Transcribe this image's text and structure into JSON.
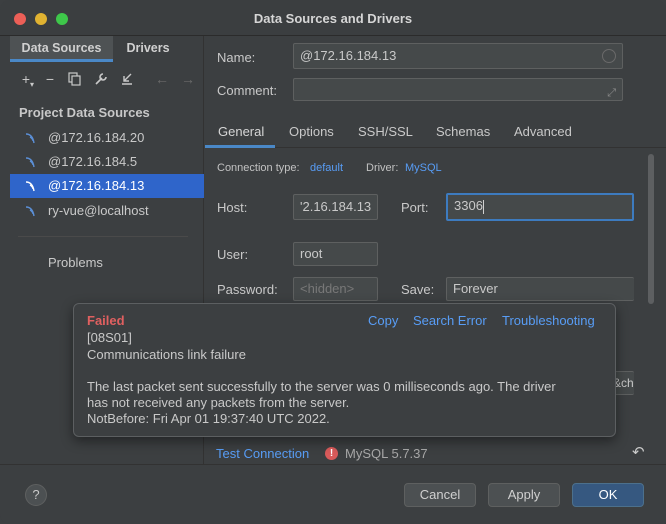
{
  "window": {
    "title": "Data Sources and Drivers"
  },
  "left_tabs": [
    "Data Sources",
    "Drivers"
  ],
  "toolbar_icons": [
    "add-icon",
    "remove-icon",
    "duplicate-icon",
    "wrench-icon",
    "import-icon",
    "back-icon",
    "forward-icon"
  ],
  "section_title": "Project Data Sources",
  "data_sources": [
    {
      "label": "@172.16.184.20",
      "selected": false
    },
    {
      "label": "@172.16.184.5",
      "selected": false
    },
    {
      "label": "@172.16.184.13",
      "selected": true
    },
    {
      "label": "ry-vue@localhost",
      "selected": false
    }
  ],
  "problems_label": "Problems",
  "form": {
    "name_label": "Name:",
    "name_value": "@172.16.184.13",
    "comment_label": "Comment:",
    "comment_value": ""
  },
  "tabs": [
    "General",
    "Options",
    "SSH/SSL",
    "Schemas",
    "Advanced"
  ],
  "general": {
    "conn_type_label": "Connection type:",
    "conn_type_value": "default",
    "driver_label": "Driver:",
    "driver_value": "MySQL",
    "host_label": "Host:",
    "host_value": "'2.16.184.13",
    "port_label": "Port:",
    "port_value": "3306",
    "user_label": "User:",
    "user_value": "root",
    "password_label": "Password:",
    "password_placeholder": "<hidden>",
    "save_label": "Save:",
    "save_value": "Forever",
    "partial_right": "&ch"
  },
  "test": {
    "link": "Test Connection",
    "driver_version": "MySQL 5.7.37"
  },
  "popup": {
    "status": "Failed",
    "actions": [
      "Copy",
      "Search Error",
      "Troubleshooting"
    ],
    "code": "[08S01]",
    "summary": "Communications link failure",
    "detail_1": "The last packet sent successfully to the server was 0 milliseconds ago. The driver",
    "detail_2": "has not received any packets from the server.",
    "detail_3": "NotBefore: Fri Apr 01 19:37:40 UTC 2022."
  },
  "buttons": {
    "help": "?",
    "cancel": "Cancel",
    "apply": "Apply",
    "ok": "OK"
  },
  "colors": {
    "accent": "#2f65ca",
    "link": "#589df6",
    "error": "#e06060",
    "primary_button": "#365880"
  }
}
